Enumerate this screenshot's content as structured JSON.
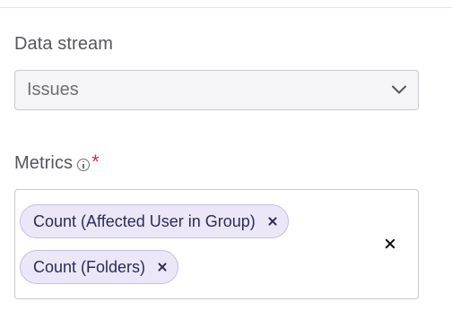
{
  "data_stream": {
    "label": "Data stream",
    "selected_value": "Issues"
  },
  "metrics": {
    "label": "Metrics",
    "required_marker": "*",
    "selected_items": [
      {
        "label": "Count (Affected User in Group)"
      },
      {
        "label": "Count (Folders)"
      }
    ]
  },
  "icons": {
    "info": "info-icon",
    "dropdown": "chevron-down-icon",
    "chip_remove": "close-icon",
    "clear_all": "close-icon"
  },
  "colors": {
    "chip_background": "#ebe7f7",
    "chip_border": "#c6bde6",
    "chip_text": "#2d2a5a",
    "required": "#e0284a",
    "select_background": "#f5f5f7"
  }
}
